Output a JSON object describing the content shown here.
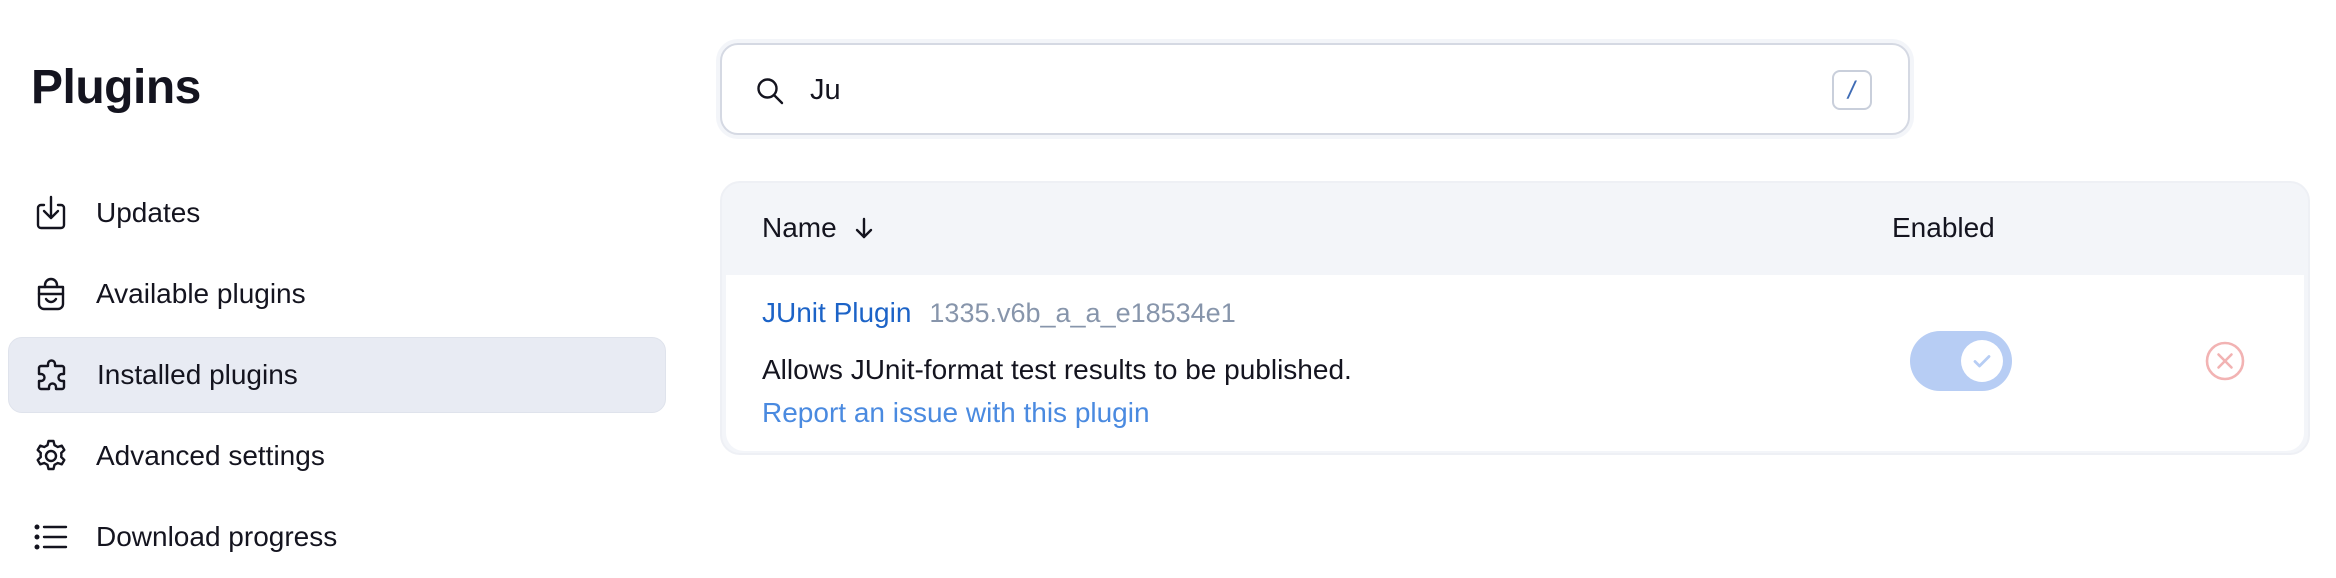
{
  "sidebar": {
    "title": "Plugins",
    "items": [
      {
        "label": "Updates",
        "icon": "download-icon",
        "active": false
      },
      {
        "label": "Available plugins",
        "icon": "shopping-bag-icon",
        "active": false
      },
      {
        "label": "Installed plugins",
        "icon": "puzzle-icon",
        "active": true
      },
      {
        "label": "Advanced settings",
        "icon": "gear-icon",
        "active": false
      },
      {
        "label": "Download progress",
        "icon": "list-icon",
        "active": false
      }
    ]
  },
  "search": {
    "value": "Ju",
    "shortcut": "/",
    "icon": "search-icon"
  },
  "table": {
    "columns": {
      "name": "Name",
      "enabled": "Enabled"
    },
    "sort_icon": "arrow-down-icon",
    "rows": [
      {
        "name": "JUnit Plugin",
        "version": "1335.v6b_a_a_e18534e1",
        "description": "Allows JUnit-format test results to be published.",
        "report_link": "Report an issue with this plugin",
        "enabled": true
      }
    ]
  },
  "colors": {
    "link": "#1c63c7",
    "report_link": "#4a8ae0",
    "version": "#8795ab",
    "toggle_on": "#b7cdf4",
    "uninstall": "#f2b3b3",
    "active_nav_bg": "#e8ebf3",
    "table_header_bg": "#f3f5f9"
  }
}
